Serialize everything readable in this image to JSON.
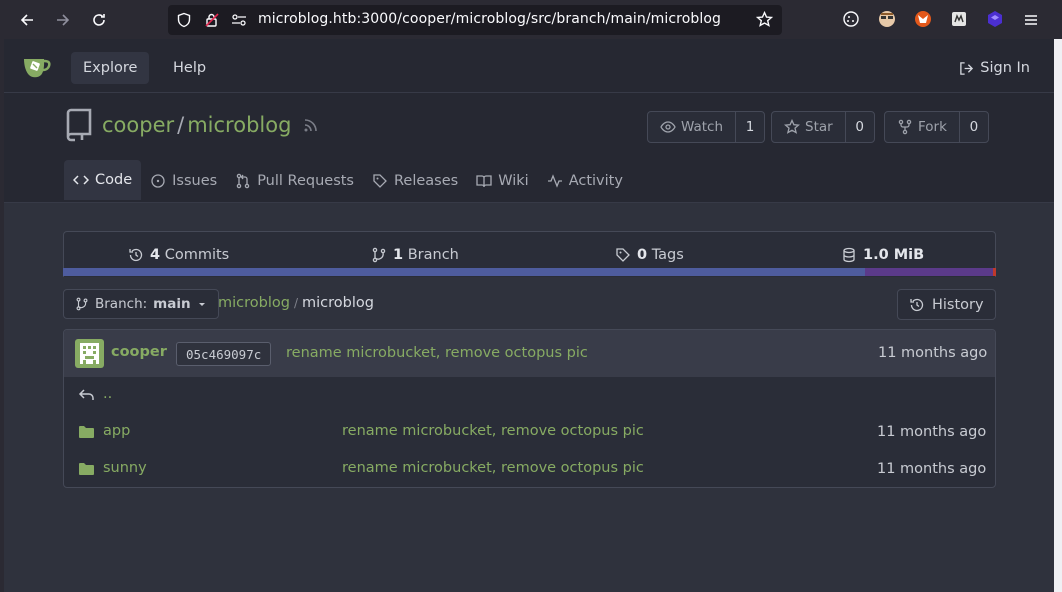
{
  "browser": {
    "url": "microblog.htb:3000/cooper/microblog/src/branch/main/microblog"
  },
  "nav": {
    "explore": "Explore",
    "help": "Help",
    "signin": "Sign In"
  },
  "repo": {
    "owner": "cooper",
    "separator": "/",
    "name": "microblog",
    "watch_label": "Watch",
    "watch_count": "1",
    "star_label": "Star",
    "star_count": "0",
    "fork_label": "Fork",
    "fork_count": "0"
  },
  "tabs": [
    {
      "label": "Code"
    },
    {
      "label": "Issues"
    },
    {
      "label": "Pull Requests"
    },
    {
      "label": "Releases"
    },
    {
      "label": "Wiki"
    },
    {
      "label": "Activity"
    }
  ],
  "stats": {
    "commits_count": "4",
    "commits_label": "Commits",
    "branch_count": "1",
    "branch_label": "Branch",
    "tags_count": "0",
    "tags_label": "Tags",
    "size": "1.0 MiB"
  },
  "languages": [
    {
      "color": "#4e5c9e",
      "fraction": 0.86
    },
    {
      "color": "#5b3a8a",
      "fraction": 0.137
    },
    {
      "color": "#c0392b",
      "fraction": 0.003
    }
  ],
  "branch": {
    "prefix": "Branch:",
    "name": "main"
  },
  "breadcrumb": {
    "root": "microblog",
    "sep": "/",
    "current": "microblog"
  },
  "history_label": "History",
  "last_commit": {
    "author": "cooper",
    "sha": "05c469097c",
    "message": "rename microbucket, remove octopus pic",
    "time": "11 months ago"
  },
  "parent_dir": "..",
  "files": [
    {
      "name": "app",
      "message": "rename microbucket, remove octopus pic",
      "time": "11 months ago"
    },
    {
      "name": "sunny",
      "message": "rename microbucket, remove octopus pic",
      "time": "11 months ago"
    }
  ],
  "colors": {
    "accent": "#87ab63",
    "background": "#2f323d",
    "header": "#262832"
  }
}
